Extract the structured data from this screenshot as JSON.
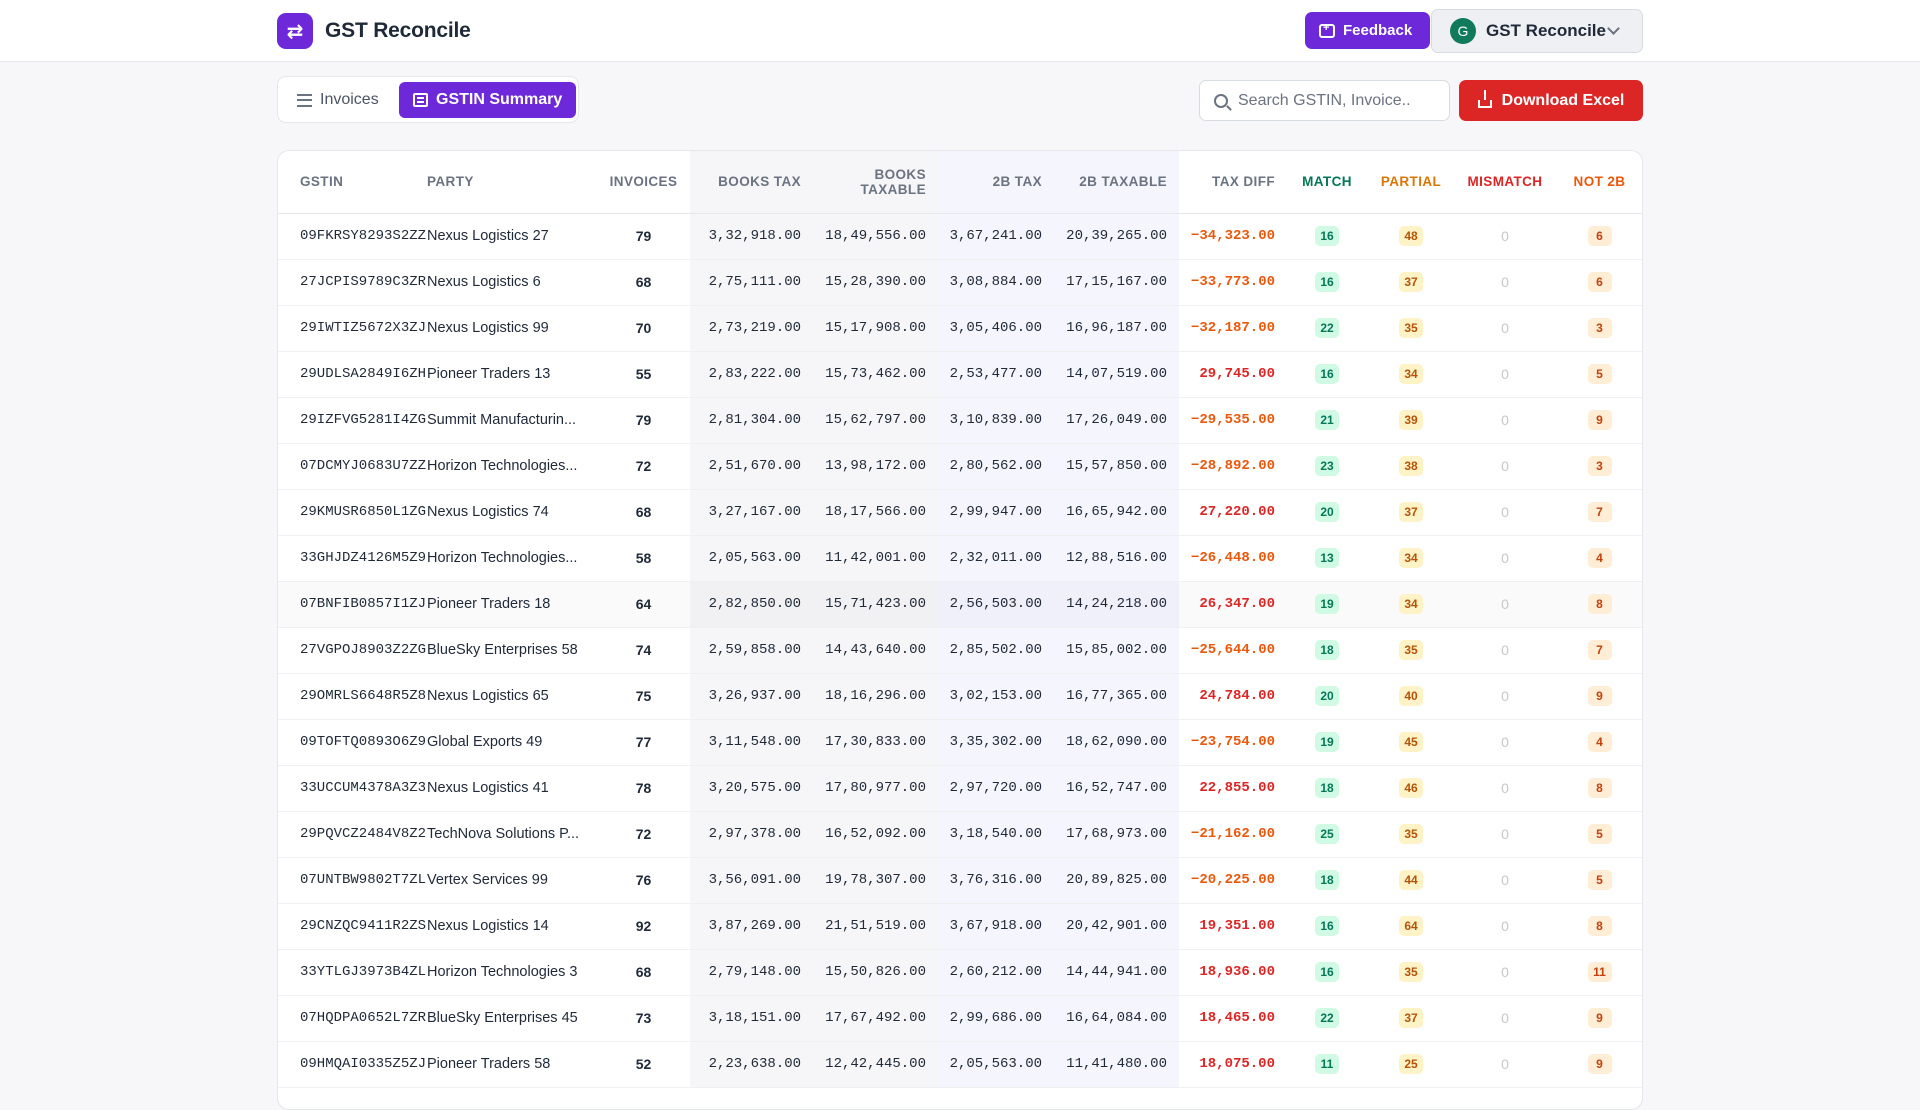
{
  "app": {
    "title": "GST Reconcile",
    "logo_glyph": "⇄"
  },
  "header": {
    "feedback_label": "Feedback",
    "account": {
      "name": "GST Reconcile",
      "initial": "G"
    }
  },
  "tabs": [
    {
      "label": "Invoices",
      "active": false
    },
    {
      "label": "GSTIN Summary",
      "active": true
    }
  ],
  "search": {
    "placeholder": "Search GSTIN, Invoice..",
    "value": ""
  },
  "download_label": "Download Excel",
  "table": {
    "headers": {
      "gstin": "GSTIN",
      "party": "PARTY",
      "invoices": "INVOICES",
      "books_tax": "BOOKS TAX",
      "books_taxable": "BOOKS TAXABLE",
      "tax_2b": "2B TAX",
      "taxable_2b": "2B TAXABLE",
      "tax_diff": "TAX DIFF",
      "match": "MATCH",
      "partial": "PARTIAL",
      "mismatch": "MISMATCH",
      "not_2b": "NOT 2B"
    },
    "rows": [
      {
        "gstin": "09FKRSY8293S2ZZ",
        "party": "Nexus Logistics 27",
        "invoices": "79",
        "books_tax": "3,32,918.00",
        "books_taxable": "18,49,556.00",
        "tax_2b": "3,67,241.00",
        "taxable_2b": "20,39,265.00",
        "tax_diff": "-34,323.00",
        "match": "16",
        "partial": "48",
        "mismatch": "0",
        "not_2b": "6"
      },
      {
        "gstin": "27JCPIS9789C3ZR",
        "party": "Nexus Logistics 6",
        "invoices": "68",
        "books_tax": "2,75,111.00",
        "books_taxable": "15,28,390.00",
        "tax_2b": "3,08,884.00",
        "taxable_2b": "17,15,167.00",
        "tax_diff": "-33,773.00",
        "match": "16",
        "partial": "37",
        "mismatch": "0",
        "not_2b": "6"
      },
      {
        "gstin": "29IWTIZ5672X3ZJ",
        "party": "Nexus Logistics 99",
        "invoices": "70",
        "books_tax": "2,73,219.00",
        "books_taxable": "15,17,908.00",
        "tax_2b": "3,05,406.00",
        "taxable_2b": "16,96,187.00",
        "tax_diff": "-32,187.00",
        "match": "22",
        "partial": "35",
        "mismatch": "0",
        "not_2b": "3"
      },
      {
        "gstin": "29UDLSA2849I6ZH",
        "party": "Pioneer Traders 13",
        "invoices": "55",
        "books_tax": "2,83,222.00",
        "books_taxable": "15,73,462.00",
        "tax_2b": "2,53,477.00",
        "taxable_2b": "14,07,519.00",
        "tax_diff": "29,745.00",
        "match": "16",
        "partial": "34",
        "mismatch": "0",
        "not_2b": "5"
      },
      {
        "gstin": "29IZFVG5281I4ZG",
        "party": "Summit Manufacturin...",
        "invoices": "79",
        "books_tax": "2,81,304.00",
        "books_taxable": "15,62,797.00",
        "tax_2b": "3,10,839.00",
        "taxable_2b": "17,26,049.00",
        "tax_diff": "-29,535.00",
        "match": "21",
        "partial": "39",
        "mismatch": "0",
        "not_2b": "9"
      },
      {
        "gstin": "07DCMYJ0683U7ZZ",
        "party": "Horizon Technologies...",
        "invoices": "72",
        "books_tax": "2,51,670.00",
        "books_taxable": "13,98,172.00",
        "tax_2b": "2,80,562.00",
        "taxable_2b": "15,57,850.00",
        "tax_diff": "-28,892.00",
        "match": "23",
        "partial": "38",
        "mismatch": "0",
        "not_2b": "3"
      },
      {
        "gstin": "29KMUSR6850L1ZG",
        "party": "Nexus Logistics 74",
        "invoices": "68",
        "books_tax": "3,27,167.00",
        "books_taxable": "18,17,566.00",
        "tax_2b": "2,99,947.00",
        "taxable_2b": "16,65,942.00",
        "tax_diff": "27,220.00",
        "match": "20",
        "partial": "37",
        "mismatch": "0",
        "not_2b": "7"
      },
      {
        "gstin": "33GHJDZ4126M5Z9",
        "party": "Horizon Technologies...",
        "invoices": "58",
        "books_tax": "2,05,563.00",
        "books_taxable": "11,42,001.00",
        "tax_2b": "2,32,011.00",
        "taxable_2b": "12,88,516.00",
        "tax_diff": "-26,448.00",
        "match": "13",
        "partial": "34",
        "mismatch": "0",
        "not_2b": "4"
      },
      {
        "gstin": "07BNFIB0857I1ZJ",
        "party": "Pioneer Traders 18",
        "invoices": "64",
        "books_tax": "2,82,850.00",
        "books_taxable": "15,71,423.00",
        "tax_2b": "2,56,503.00",
        "taxable_2b": "14,24,218.00",
        "tax_diff": "26,347.00",
        "match": "19",
        "partial": "34",
        "mismatch": "0",
        "not_2b": "8"
      },
      {
        "gstin": "27VGPOJ8903Z2ZG",
        "party": "BlueSky Enterprises 58",
        "invoices": "74",
        "books_tax": "2,59,858.00",
        "books_taxable": "14,43,640.00",
        "tax_2b": "2,85,502.00",
        "taxable_2b": "15,85,002.00",
        "tax_diff": "-25,644.00",
        "match": "18",
        "partial": "35",
        "mismatch": "0",
        "not_2b": "7"
      },
      {
        "gstin": "29OMRLS6648R5Z8",
        "party": "Nexus Logistics 65",
        "invoices": "75",
        "books_tax": "3,26,937.00",
        "books_taxable": "18,16,296.00",
        "tax_2b": "3,02,153.00",
        "taxable_2b": "16,77,365.00",
        "tax_diff": "24,784.00",
        "match": "20",
        "partial": "40",
        "mismatch": "0",
        "not_2b": "9"
      },
      {
        "gstin": "09TOFTQ0893O6Z9",
        "party": "Global Exports 49",
        "invoices": "77",
        "books_tax": "3,11,548.00",
        "books_taxable": "17,30,833.00",
        "tax_2b": "3,35,302.00",
        "taxable_2b": "18,62,090.00",
        "tax_diff": "-23,754.00",
        "match": "19",
        "partial": "45",
        "mismatch": "0",
        "not_2b": "4"
      },
      {
        "gstin": "33UCCUM4378A3Z3",
        "party": "Nexus Logistics 41",
        "invoices": "78",
        "books_tax": "3,20,575.00",
        "books_taxable": "17,80,977.00",
        "tax_2b": "2,97,720.00",
        "taxable_2b": "16,52,747.00",
        "tax_diff": "22,855.00",
        "match": "18",
        "partial": "46",
        "mismatch": "0",
        "not_2b": "8"
      },
      {
        "gstin": "29PQVCZ2484V8Z2",
        "party": "TechNova Solutions P...",
        "invoices": "72",
        "books_tax": "2,97,378.00",
        "books_taxable": "16,52,092.00",
        "tax_2b": "3,18,540.00",
        "taxable_2b": "17,68,973.00",
        "tax_diff": "-21,162.00",
        "match": "25",
        "partial": "35",
        "mismatch": "0",
        "not_2b": "5"
      },
      {
        "gstin": "07UNTBW9802T7ZL",
        "party": "Vertex Services 99",
        "invoices": "76",
        "books_tax": "3,56,091.00",
        "books_taxable": "19,78,307.00",
        "tax_2b": "3,76,316.00",
        "taxable_2b": "20,89,825.00",
        "tax_diff": "-20,225.00",
        "match": "18",
        "partial": "44",
        "mismatch": "0",
        "not_2b": "5"
      },
      {
        "gstin": "29CNZQC9411R2ZS",
        "party": "Nexus Logistics 14",
        "invoices": "92",
        "books_tax": "3,87,269.00",
        "books_taxable": "21,51,519.00",
        "tax_2b": "3,67,918.00",
        "taxable_2b": "20,42,901.00",
        "tax_diff": "19,351.00",
        "match": "16",
        "partial": "64",
        "mismatch": "0",
        "not_2b": "8"
      },
      {
        "gstin": "33YTLGJ3973B4ZL",
        "party": "Horizon Technologies 3",
        "invoices": "68",
        "books_tax": "2,79,148.00",
        "books_taxable": "15,50,826.00",
        "tax_2b": "2,60,212.00",
        "taxable_2b": "14,44,941.00",
        "tax_diff": "18,936.00",
        "match": "16",
        "partial": "35",
        "mismatch": "0",
        "not_2b": "11"
      },
      {
        "gstin": "07HQDPA0652L7ZR",
        "party": "BlueSky Enterprises 45",
        "invoices": "73",
        "books_tax": "3,18,151.00",
        "books_taxable": "17,67,492.00",
        "tax_2b": "2,99,686.00",
        "taxable_2b": "16,64,084.00",
        "tax_diff": "18,465.00",
        "match": "22",
        "partial": "37",
        "mismatch": "0",
        "not_2b": "9"
      },
      {
        "gstin": "09HMQAI0335Z5ZJ",
        "party": "Pioneer Traders 58",
        "invoices": "52",
        "books_tax": "2,23,638.00",
        "books_taxable": "12,42,445.00",
        "tax_2b": "2,05,563.00",
        "taxable_2b": "11,41,480.00",
        "tax_diff": "18,075.00",
        "match": "11",
        "partial": "25",
        "mismatch": "0",
        "not_2b": "9"
      }
    ]
  },
  "colors": {
    "brand": "#6d28d9",
    "download": "#dc2626",
    "match": "#047857",
    "partial": "#d97706",
    "mismatch": "#dc2626",
    "not_2b": "#ea580c"
  }
}
